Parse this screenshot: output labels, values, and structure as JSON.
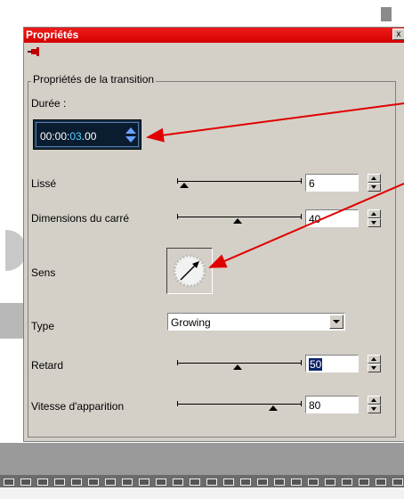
{
  "window": {
    "title": "Propriétés",
    "close_label": "x",
    "pin_icon": "pushpin-icon"
  },
  "group": {
    "legend": "Propriétés de la transition"
  },
  "duration": {
    "label": "Durée :",
    "value_prefix": "00:00:",
    "value_highlight": "03",
    "value_suffix": ".00"
  },
  "properties": {
    "smooth": {
      "label": "Lissé",
      "value": "6"
    },
    "square_size": {
      "label": "Dimensions du carré",
      "value": "40"
    },
    "direction": {
      "label": "Sens",
      "icon": "direction-dial-icon"
    },
    "type": {
      "label": "Type",
      "value": "Growing"
    },
    "delay": {
      "label": "Retard",
      "value": "50"
    },
    "appear_speed": {
      "label": "Vitesse d'apparition",
      "value": "80"
    }
  },
  "colors": {
    "title_bg": "#e01010",
    "panel_bg": "#d4d0c8",
    "annotation_arrow": "#e00000",
    "duration_bg": "#091c30"
  }
}
